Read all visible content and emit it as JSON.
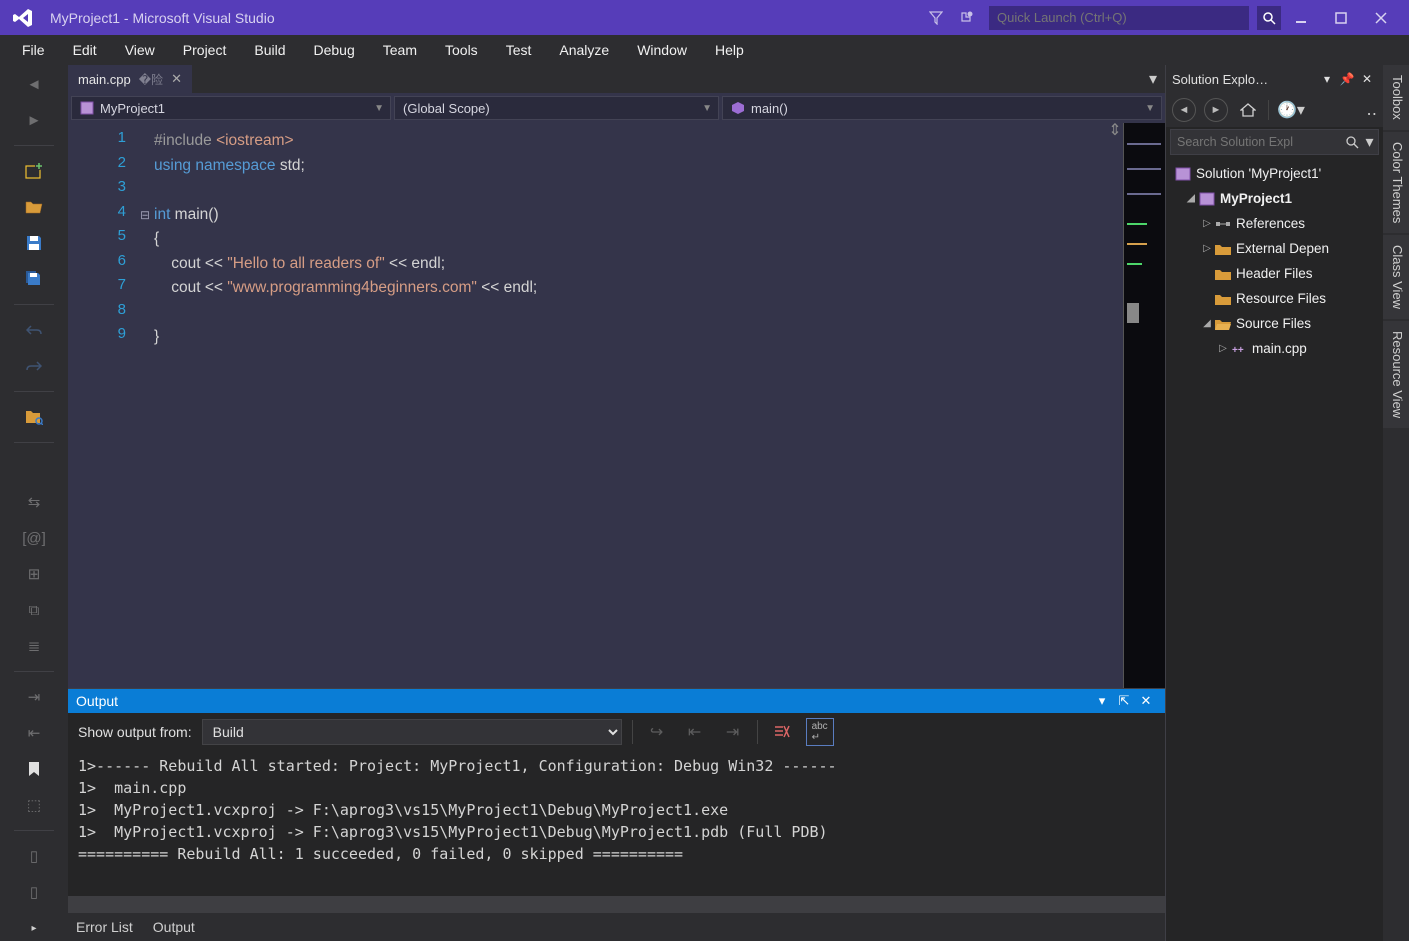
{
  "titlebar": {
    "title": "MyProject1 - Microsoft Visual Studio",
    "quick_launch_placeholder": "Quick Launch (Ctrl+Q)"
  },
  "menu": [
    "File",
    "Edit",
    "View",
    "Project",
    "Build",
    "Debug",
    "Team",
    "Tools",
    "Test",
    "Analyze",
    "Window",
    "Help"
  ],
  "tab": {
    "name": "main.cpp"
  },
  "nav": {
    "project": "MyProject1",
    "scope": "(Global Scope)",
    "function": "main()"
  },
  "code": {
    "lines": [
      {
        "n": "1",
        "fold": "",
        "html": "<span class='pp'>#include</span> <span class='str'>&lt;iostream&gt;</span>"
      },
      {
        "n": "2",
        "fold": "",
        "html": "<span class='kw'>using</span> <span class='kw'>namespace</span> std;"
      },
      {
        "n": "3",
        "fold": "",
        "html": ""
      },
      {
        "n": "4",
        "fold": "⊟",
        "html": "<span class='kw'>int</span> main()"
      },
      {
        "n": "5",
        "fold": "",
        "html": "{"
      },
      {
        "n": "6",
        "fold": "",
        "html": "    cout &lt;&lt; <span class='str'>\"Hello to all readers of\"</span> &lt;&lt; endl;"
      },
      {
        "n": "7",
        "fold": "",
        "html": "    cout &lt;&lt; <span class='str'>\"www.programming4beginners.com\"</span> &lt;&lt; endl;"
      },
      {
        "n": "8",
        "fold": "",
        "html": ""
      },
      {
        "n": "9",
        "fold": "",
        "html": "}"
      }
    ]
  },
  "output": {
    "title": "Output",
    "show_from_label": "Show output from:",
    "show_from_value": "Build",
    "text": "1>------ Rebuild All started: Project: MyProject1, Configuration: Debug Win32 ------\n1>  main.cpp\n1>  MyProject1.vcxproj -> F:\\aprog3\\vs15\\MyProject1\\Debug\\MyProject1.exe\n1>  MyProject1.vcxproj -> F:\\aprog3\\vs15\\MyProject1\\Debug\\MyProject1.pdb (Full PDB)\n========== Rebuild All: 1 succeeded, 0 failed, 0 skipped =========="
  },
  "bottom_tabs": [
    "Error List",
    "Output"
  ],
  "solution_explorer": {
    "title": "Solution Explo…",
    "search_placeholder": "Search Solution Expl",
    "tree": {
      "solution": "Solution 'MyProject1'",
      "project": "MyProject1",
      "nodes": [
        {
          "label": "References",
          "icon": "references"
        },
        {
          "label": "External Depen",
          "icon": "folder-ext"
        },
        {
          "label": "Header Files",
          "icon": "folder"
        },
        {
          "label": "Resource Files",
          "icon": "folder"
        },
        {
          "label": "Source Files",
          "icon": "folder-open",
          "expanded": true,
          "children": [
            {
              "label": "main.cpp",
              "icon": "cpp"
            }
          ]
        }
      ]
    }
  },
  "right_tabs": [
    "Toolbox",
    "Color Themes",
    "Class View",
    "Resource View"
  ]
}
